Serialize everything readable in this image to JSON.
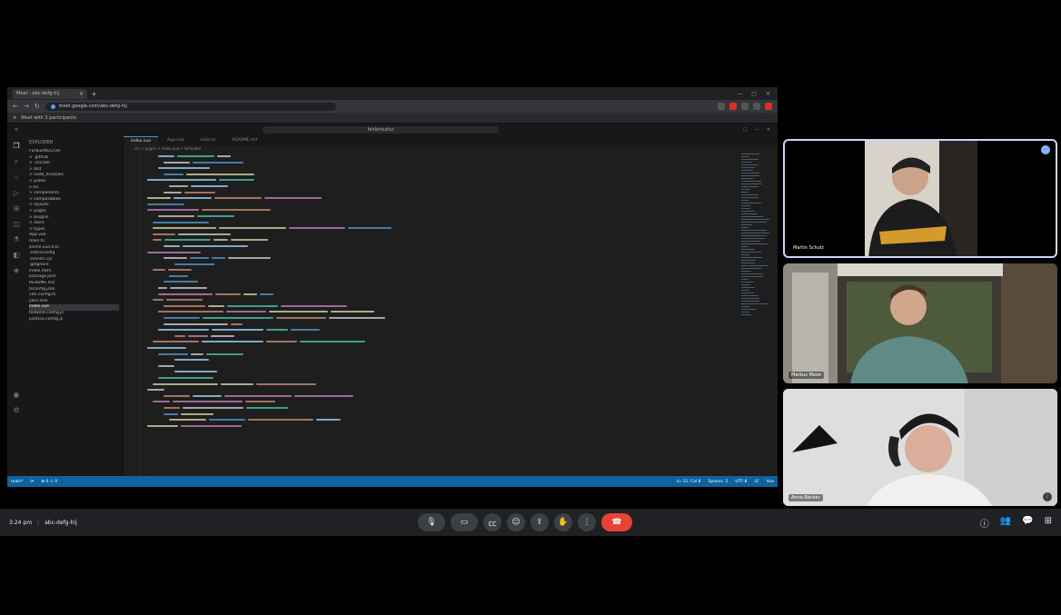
{
  "browser": {
    "tab_title": "Meet - abc-defg-hij",
    "url": "meet.google.com/abc-defg-hij",
    "bookmark": "Meet with 3 participants",
    "new_tab": "+",
    "nav_back": "←",
    "nav_forward": "→",
    "nav_reload": "↻",
    "win_min": "—",
    "win_max": "▢",
    "win_close": "✕"
  },
  "vscode": {
    "command_center": "fehlerkultur",
    "explorer_header": "EXPLORER",
    "tree": [
      "FEHLERKULTUR",
      "> .github",
      "> .vscode",
      "> dist",
      "> node_modules",
      "> public",
      "v src",
      "  > components",
      "  > composables",
      "  > layouts",
      "  > pages",
      "  > plugins",
      "  > store",
      "  > types",
      "  App.vue",
      "  main.ts",
      "  shims-vue.d.ts",
      ".editorconfig",
      ".eslintrc.cjs",
      ".gitignore",
      "index.html",
      "package.json",
      "README.md",
      "tsconfig.json",
      "vite.config.ts",
      "yarn.lock",
      "index.vue",
      "tailwind.config.js",
      "postcss.config.js"
    ],
    "selected_tree_index": 26,
    "editor_tabs": [
      "index.vue",
      "App.vue",
      "main.ts",
      "README.md"
    ],
    "breadcrumb": "src > pages > index.vue > template",
    "status_left": [
      "main*",
      "⟳",
      "⊗ 0 ⚠ 0"
    ],
    "status_right": [
      "Ln 12, Col 8",
      "Spaces: 2",
      "UTF-8",
      "LF",
      "Vue"
    ]
  },
  "participants": [
    {
      "name": "Martin Schulz"
    },
    {
      "name": "Markus Meier"
    },
    {
      "name": "Anna Becker"
    }
  ],
  "meeting": {
    "time": "3:24 pm",
    "code": "abc-defg-hij",
    "separator": "|"
  },
  "colors": {
    "hangup": "#ea4335",
    "statusbar": "#0e639c",
    "active_tile_border": "#c9d7ff"
  }
}
